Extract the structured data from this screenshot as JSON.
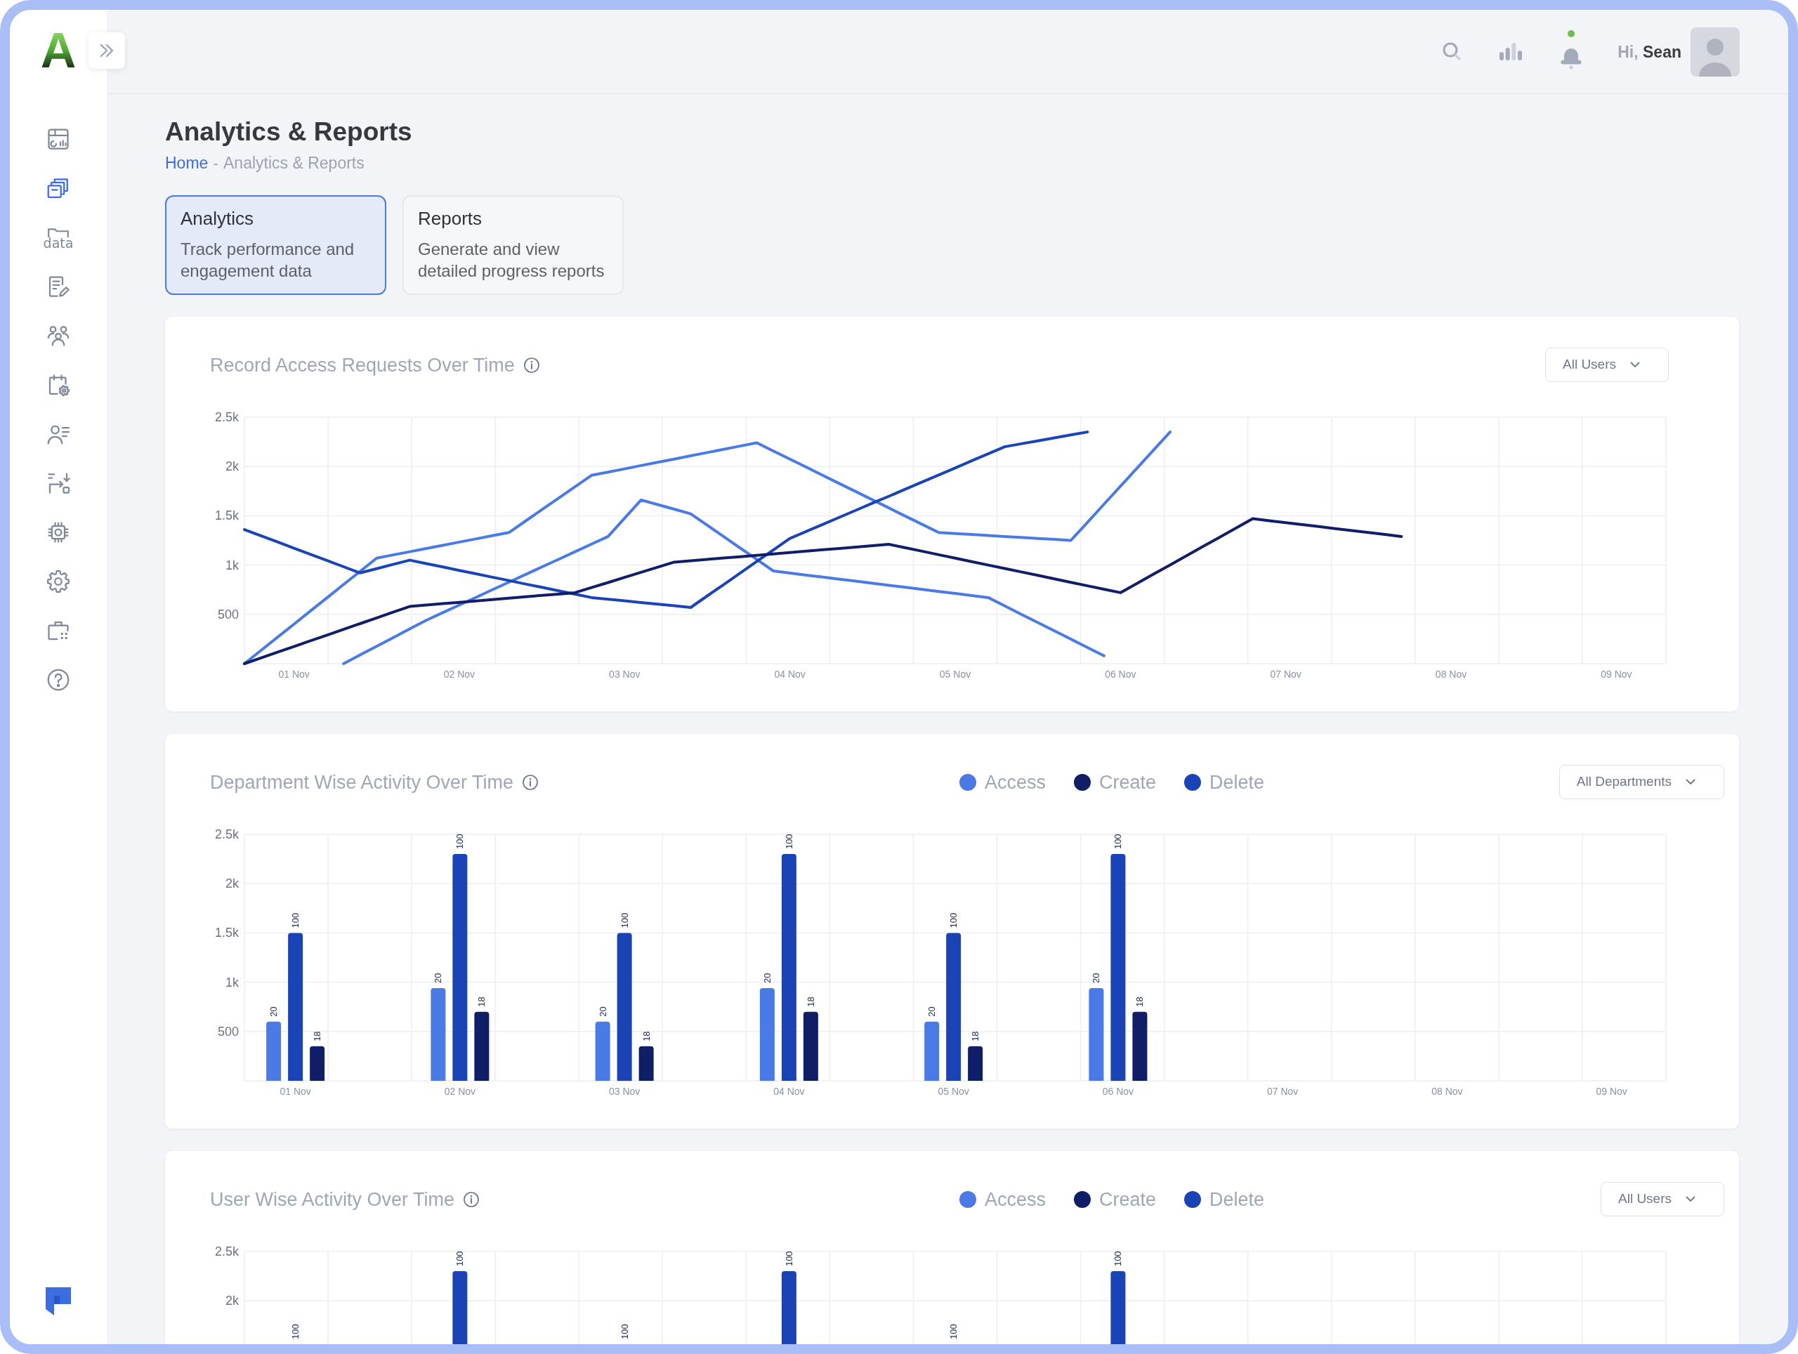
{
  "brand": {
    "logo_letter": "A"
  },
  "sidebar": {
    "items": [
      {
        "selected": false
      },
      {
        "selected": true
      },
      {
        "selected": false,
        "label": "data"
      },
      {
        "selected": false
      },
      {
        "selected": false
      },
      {
        "selected": false
      },
      {
        "selected": false
      },
      {
        "selected": false
      },
      {
        "selected": false
      },
      {
        "selected": false
      },
      {
        "selected": false
      },
      {
        "selected": false
      }
    ]
  },
  "header": {
    "notifications": {
      "unread": true
    },
    "greeting": "Hi, **Sean**"
  },
  "page": {
    "title": "Analytics & Reports",
    "breadcrumb": {
      "items": [
        {
          "label": "Home"
        },
        {
          "label": "Analytics & Reports"
        }
      ],
      "separator": "-"
    }
  },
  "tabs": [
    {
      "title": "Analytics",
      "description": "Track performance and engagement data",
      "selected": true
    },
    {
      "title": "Reports",
      "description": "Generate and view detailed progress reports",
      "selected": false
    }
  ],
  "charts": [
    {
      "title": "Record Access Requests Over Time",
      "filter": "All Users",
      "chart_data": {
        "type": "line",
        "grid": true,
        "categories": [
          null,
          null,
          null,
          "01 Nov",
          null,
          null,
          null,
          null,
          null,
          null,
          null,
          null,
          null,
          "02 Nov",
          null,
          null,
          null,
          null,
          null,
          null,
          null,
          null,
          null,
          "03 Nov",
          null,
          null,
          null,
          null,
          null,
          null,
          null,
          null,
          null,
          "04 Nov",
          null,
          null,
          null,
          null,
          null,
          null,
          null,
          null,
          null,
          "05 Nov",
          null,
          null,
          null,
          null,
          null,
          null,
          null,
          null,
          null,
          "06 Nov",
          null,
          null,
          null,
          null,
          null,
          null,
          null,
          null,
          null,
          "07 Nov",
          null,
          null,
          null,
          null,
          null,
          null,
          null,
          null,
          null,
          "08 Nov",
          null,
          null,
          null,
          null,
          null,
          null,
          null,
          null,
          null,
          "09 Nov",
          null,
          null,
          null
        ],
        "ylim": [
          0,
          2500
        ],
        "yticks": [
          {
            "value": 500,
            "label": "500"
          },
          {
            "value": 1000,
            "label": "1k"
          },
          {
            "value": 1500,
            "label": "1.5k"
          },
          {
            "value": 2000,
            "label": "2k"
          },
          {
            "value": 2500,
            "label": "2.5k"
          }
        ],
        "series": [
          {
            "color": "#4a7ae6",
            "values": [
              0,
              134,
              268,
              401,
              535,
              669,
              803,
              936,
              1070,
              1103,
              1135,
              1168,
              1200,
              1233,
              1265,
              1298,
              1330,
              1446,
              1562,
              1678,
              1794,
              1910,
              1943,
              1976,
              2009,
              2042,
              2075,
              2108,
              2141,
              2174,
              2207,
              2240,
              2157,
              2075,
              1992,
              1909,
              1826,
              1744,
              1661,
              1578,
              1495,
              1413,
              1330,
              1320,
              1310,
              1300,
              1290,
              1280,
              1270,
              1260,
              1250,
              1433,
              1617,
              1800,
              1983,
              2167,
              2350,
              null,
              null,
              null,
              null,
              null,
              null,
              null,
              null,
              null,
              null,
              null,
              null,
              null,
              null,
              null,
              null,
              null,
              null,
              null,
              null,
              null,
              null,
              null,
              null,
              null,
              null,
              null,
              null,
              null,
              null
            ]
          },
          {
            "color": "#4a7ae6",
            "values": [
              null,
              null,
              null,
              null,
              null,
              null,
              0,
              88,
              176,
              264,
              352,
              440,
              517,
              595,
              672,
              749,
              826,
              904,
              981,
              1058,
              1135,
              1213,
              1290,
              1475,
              1660,
              1613,
              1567,
              1520,
              1404,
              1288,
              1172,
              1056,
              940,
              919,
              898,
              878,
              857,
              836,
              815,
              795,
              774,
              753,
              732,
              712,
              691,
              670,
              586,
              501,
              417,
              333,
              249,
              164,
              80,
              null,
              null,
              null,
              null,
              null,
              null,
              null,
              null,
              null,
              null,
              null,
              null,
              null,
              null,
              null,
              null,
              null,
              null,
              null,
              null,
              null,
              null,
              null,
              null,
              null,
              null,
              null,
              null,
              null,
              null,
              null,
              null,
              null,
              null
            ]
          },
          {
            "color": "#1a44b6",
            "values": [
              1360,
              1297,
              1234,
              1171,
              1109,
              1046,
              983,
              920,
              963,
              1007,
              1050,
              1015,
              981,
              946,
              912,
              877,
              843,
              808,
              774,
              739,
              705,
              670,
              653,
              637,
              620,
              603,
              587,
              570,
              687,
              803,
              920,
              1037,
              1153,
              1270,
              1342,
              1413,
              1485,
              1556,
              1628,
              1699,
              1771,
              1842,
              1914,
              1985,
              2057,
              2128,
              2200,
              2230,
              2260,
              2290,
              2320,
              2350,
              null,
              null,
              null,
              null,
              null,
              null,
              null,
              null,
              null,
              null,
              null,
              null,
              null,
              null,
              null,
              null,
              null,
              null,
              null,
              null,
              null,
              null,
              null,
              null,
              null,
              null,
              null,
              null,
              null,
              null,
              null,
              null,
              null,
              null,
              null
            ]
          },
          {
            "color": "#0f1e66",
            "values": [
              0,
              58,
              116,
              174,
              232,
              290,
              348,
              406,
              464,
              522,
              580,
              594,
              608,
              622,
              636,
              650,
              664,
              678,
              692,
              706,
              720,
              772,
              823,
              875,
              927,
              978,
              1030,
              1044,
              1058,
              1072,
              1085,
              1099,
              1113,
              1127,
              1141,
              1155,
              1168,
              1182,
              1196,
              1210,
              1175,
              1140,
              1105,
              1070,
              1035,
              1000,
              965,
              930,
              895,
              860,
              825,
              790,
              755,
              720,
              814,
              908,
              1001,
              1095,
              1189,
              1283,
              1376,
              1470,
              1450,
              1430,
              1410,
              1390,
              1370,
              1350,
              1330,
              1310,
              1290,
              null,
              null,
              null,
              null,
              null,
              null,
              null,
              null,
              null,
              null,
              null,
              null,
              null,
              null,
              null,
              null
            ]
          }
        ]
      }
    },
    {
      "title": "Department Wise Activity Over Time",
      "legend": [
        {
          "label": "Access",
          "color": "#4a7ae6"
        },
        {
          "label": "Create",
          "color": "#0f1e66"
        },
        {
          "label": "Delete",
          "color": "#1a44b6"
        }
      ],
      "filter": "All Departments",
      "chart_data": {
        "type": "bar",
        "grid": true,
        "categories": [
          "01 Nov",
          "02 Nov",
          "03 Nov",
          "04 Nov",
          "05 Nov",
          "06 Nov",
          "07 Nov",
          "08 Nov",
          "09 Nov"
        ],
        "ylim": [
          0,
          2500
        ],
        "yticks": [
          {
            "value": 500,
            "label": "500"
          },
          {
            "value": 1000,
            "label": "1k"
          },
          {
            "value": 1500,
            "label": "1.5k"
          },
          {
            "value": 2000,
            "label": "2k"
          },
          {
            "value": 2500,
            "label": "2.5k"
          }
        ],
        "series": [
          {
            "color": "#4a7ae6",
            "values": [
              600,
              940,
              600,
              940,
              600,
              940,
              null,
              null,
              null
            ]
          },
          {
            "color": "#1a44b6",
            "values": [
              1500,
              2300,
              1500,
              2300,
              1500,
              2300,
              null,
              null,
              null
            ]
          },
          {
            "color": "#0f1e66",
            "values": [
              350,
              700,
              350,
              700,
              350,
              700,
              null,
              null,
              null
            ]
          }
        ],
        "annotations": [
          "20",
          "100",
          "18",
          "20",
          "100",
          "18",
          "20",
          "100",
          "18",
          "20",
          "100",
          "18",
          "20",
          "100",
          "18",
          "20",
          "100",
          "18"
        ]
      }
    },
    {
      "title": "User Wise Activity Over Time",
      "legend": [
        {
          "label": "Access",
          "color": "#4a7ae6"
        },
        {
          "label": "Create",
          "color": "#0f1e66"
        },
        {
          "label": "Delete",
          "color": "#1a44b6"
        }
      ],
      "filter": "All Users",
      "cut_off_labels": [
        "100",
        "100",
        "100"
      ],
      "chart_data": {
        "type": "bar",
        "grid": true,
        "categories": [
          null,
          null,
          null,
          null,
          null,
          null,
          null,
          null,
          null
        ],
        "ylim": [
          1560,
          2500
        ],
        "yticks": [
          {
            "value": 2000,
            "label": "2k"
          },
          {
            "value": 2500,
            "label": "2.5k"
          }
        ],
        "series": [
          {
            "color": "#1a44b6",
            "values": [
              null,
              2300,
              null,
              2300,
              null,
              2300,
              null,
              null,
              null
            ]
          }
        ],
        "annotations": [
          "100",
          "100",
          "100"
        ]
      }
    }
  ]
}
